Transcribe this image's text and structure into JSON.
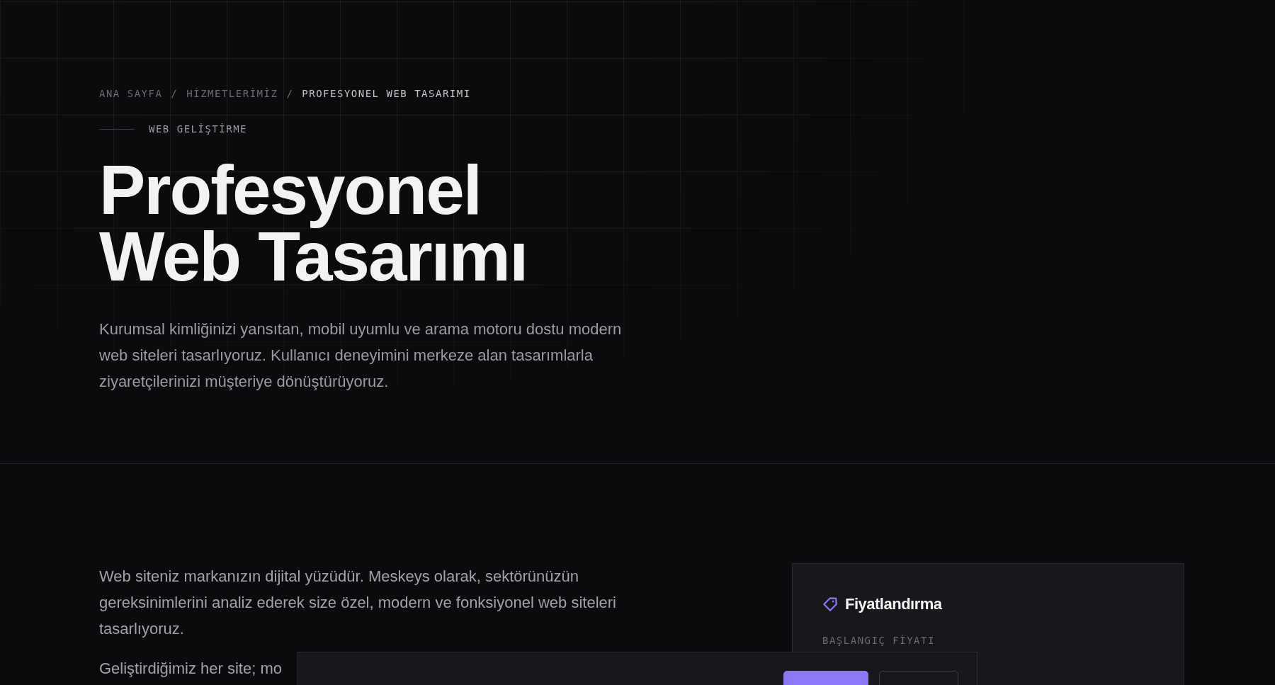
{
  "breadcrumb": [
    {
      "label": "ANA SAYFA",
      "current": false
    },
    {
      "label": "HİZMETLERİMİZ",
      "current": false
    },
    {
      "label": "PROFESYONEL WEB TASARIMI",
      "current": true
    }
  ],
  "breadcrumb_separator": "/",
  "eyebrow": "WEB GELİŞTİRME",
  "title_lines": [
    "Profesyonel",
    "Web Tasarımı"
  ],
  "intro": "Kurumsal kimliğinizi yansıtan, mobil uyumlu ve arama motoru dostu modern web siteleri tasarlıyoruz. Kullanıcı deneyimini merkeze alan tasarımlarla ziyaretçilerinizi müşteriye dönüştürüyoruz.",
  "body_paragraphs": [
    "Web siteniz markanızın dijital yüzüdür. Meskeys olarak, sektörünüzün gereksinimlerini analiz ederek size özel, modern ve fonksiyonel web siteleri tasarlıyoruz.",
    "Geliştirdiğimiz her site; mo"
  ],
  "pricing_card": {
    "title": "Fiyatlandırma",
    "label": "BAŞLANGIÇ FİYATI"
  },
  "cookie_banner": {
    "buttons": [
      {
        "kind": "primary"
      },
      {
        "kind": "secondary"
      }
    ]
  }
}
